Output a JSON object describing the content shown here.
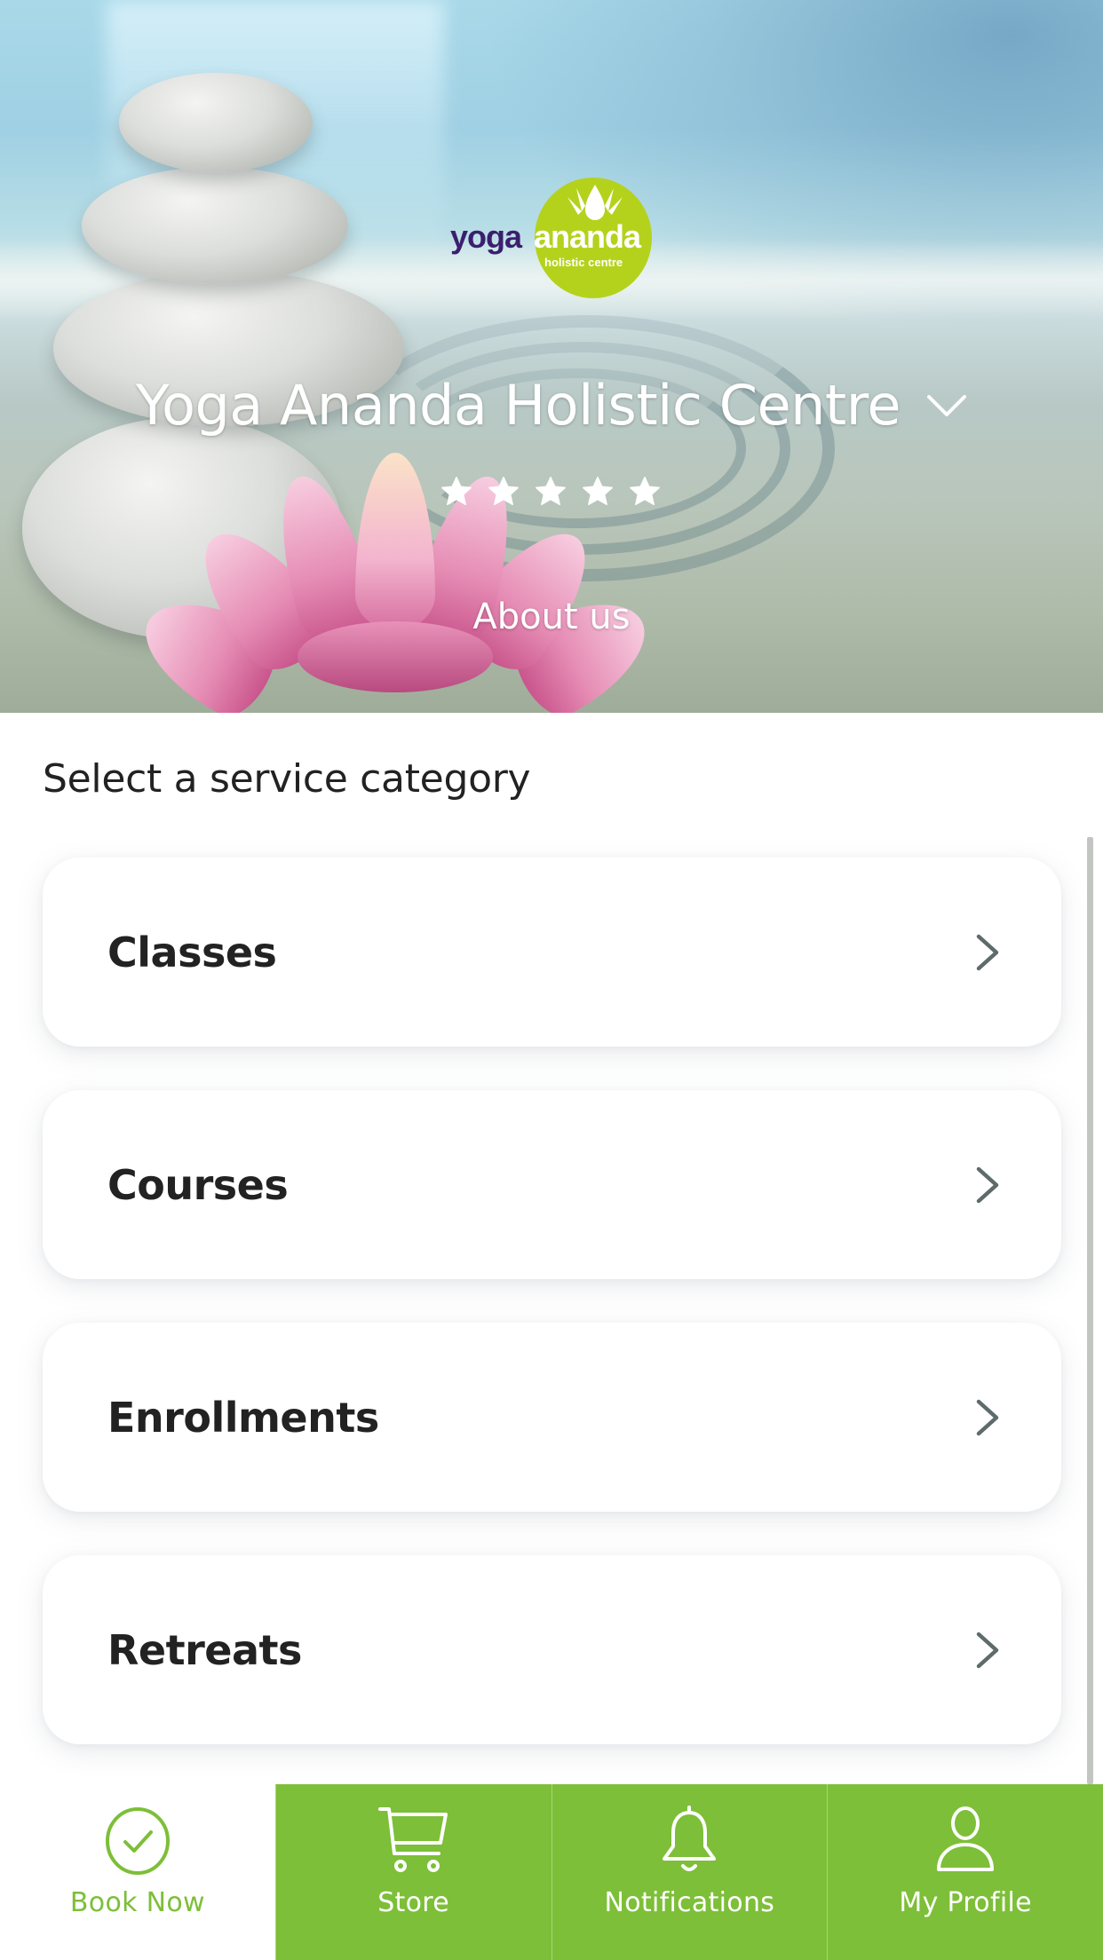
{
  "hero": {
    "logo": {
      "word1": "yoga",
      "word2": "ananda",
      "tagline": "holistic centre",
      "circle_color": "#b4d21c",
      "word1_color": "#3b1f6e"
    },
    "title": "Yoga Ananda Holistic Centre",
    "title_icon": "chevron-down-icon",
    "rating": {
      "value": 5,
      "max": 5,
      "icon": "star-icon"
    },
    "about_link": "About us"
  },
  "main": {
    "heading": "Select a service category",
    "categories": [
      {
        "label": "Classes",
        "icon": "chevron-right-icon"
      },
      {
        "label": "Courses",
        "icon": "chevron-right-icon"
      },
      {
        "label": "Enrollments",
        "icon": "chevron-right-icon"
      },
      {
        "label": "Retreats",
        "icon": "chevron-right-icon"
      }
    ]
  },
  "bottom_nav": {
    "accent_color": "#7dbf38",
    "active_index": 0,
    "tabs": [
      {
        "label": "Book Now",
        "icon": "check-circle-icon"
      },
      {
        "label": "Store",
        "icon": "cart-icon"
      },
      {
        "label": "Notifications",
        "icon": "bell-icon"
      },
      {
        "label": "My Profile",
        "icon": "user-icon"
      }
    ]
  }
}
